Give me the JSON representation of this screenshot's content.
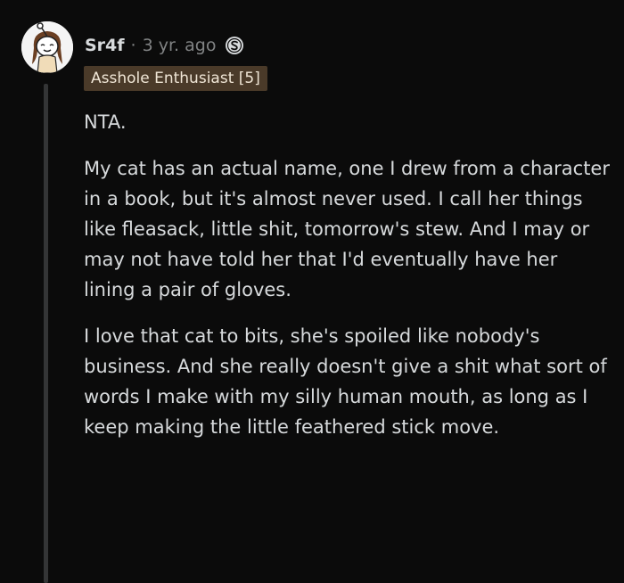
{
  "comment": {
    "author": "Sr4f",
    "separator": "·",
    "timestamp": "3 yr. ago",
    "flair": "Asshole Enthusiast [5]",
    "paragraphs": [
      "NTA.",
      "My cat has an actual name, one I drew from a character in a book, but it's almost never used. I call her things like fleasack, little shit, tomorrow's stew. And I may or may not have told her that I'd eventually have her lining a pair of gloves.",
      "I love that cat to bits, she's spoiled like nobody's business. And she really doesn't give a shit what sort of words I make with my silly human mouth, as long as I keep making the little feathered stick move."
    ]
  },
  "icons": {
    "avatar": "snoo-avatar",
    "badge": "coin-badge-icon"
  },
  "colors": {
    "background": "#0b0b0b",
    "text": "#d7dadc",
    "muted": "#818384",
    "flair_bg": "#4a3a29",
    "thread_line": "#343536"
  }
}
